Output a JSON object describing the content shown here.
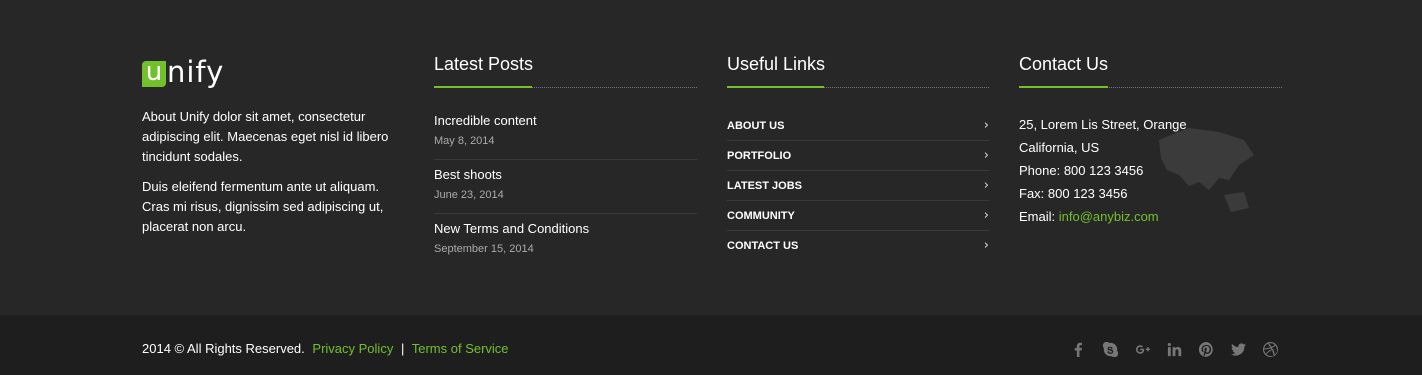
{
  "about": {
    "logo_first": "u",
    "logo_rest": "nify",
    "paragraph1": "About Unify dolor sit amet, consectetur adipiscing elit. Maecenas eget nisl id libero tincidunt sodales.",
    "paragraph2": "Duis eleifend fermentum ante ut aliquam. Cras mi risus, dignissim sed adipiscing ut, placerat non arcu."
  },
  "posts": {
    "heading": "Latest Posts",
    "items": [
      {
        "title": "Incredible content",
        "date": "May 8, 2014"
      },
      {
        "title": "Best shoots",
        "date": "June 23, 2014"
      },
      {
        "title": "New Terms and Conditions",
        "date": "September 15, 2014"
      }
    ]
  },
  "links": {
    "heading": "Useful Links",
    "items": [
      {
        "label": "About us"
      },
      {
        "label": "Portfolio"
      },
      {
        "label": "Latest jobs"
      },
      {
        "label": "Community"
      },
      {
        "label": "Contact us"
      }
    ]
  },
  "contact": {
    "heading": "Contact Us",
    "address1": "25, Lorem Lis Street, Orange",
    "address2": "California, US",
    "phone": "Phone: 800 123 3456",
    "fax": "Fax: 800 123 3456",
    "email_label": "Email: ",
    "email": "info@anybiz.com"
  },
  "bottom": {
    "copyright": "2014 © All Rights Reserved.",
    "privacy": "Privacy Policy",
    "separator": "|",
    "terms": "Terms of Service"
  },
  "social": [
    "facebook-icon",
    "skype-icon",
    "google-plus-icon",
    "linkedin-icon",
    "pinterest-icon",
    "twitter-icon",
    "dribbble-icon"
  ],
  "colors": {
    "accent": "#72c02c",
    "background": "#272727",
    "bottom_bar": "#1e1e1e"
  }
}
